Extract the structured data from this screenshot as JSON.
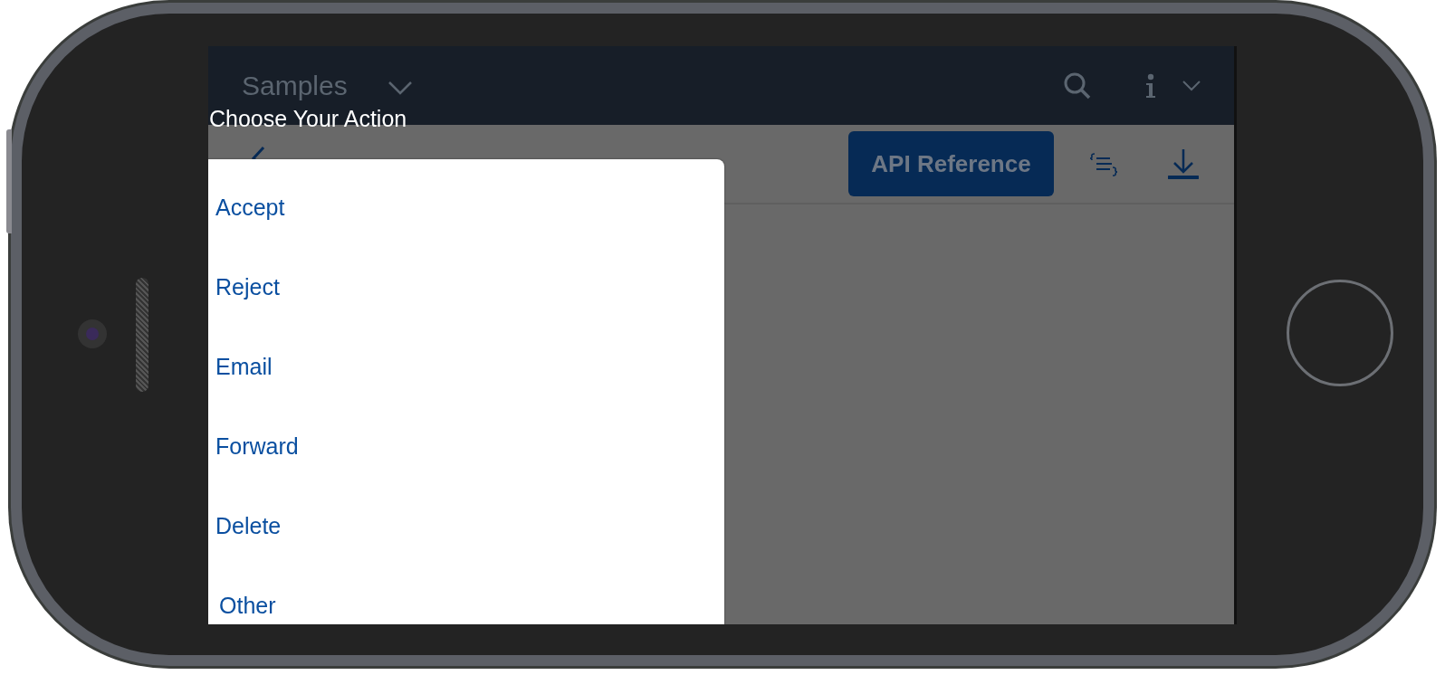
{
  "header": {
    "title": "Samples"
  },
  "page": {
    "api_button": "API Reference"
  },
  "action_sheet": {
    "title": "Choose Your Action",
    "actions": [
      {
        "label": "Accept",
        "kind": "plain"
      },
      {
        "label": "Reject",
        "kind": "plain"
      },
      {
        "label": "Email",
        "kind": "plain"
      },
      {
        "label": "Forward",
        "kind": "plain"
      },
      {
        "label": "Delete",
        "kind": "plain"
      },
      {
        "label": "Other",
        "kind": "indented"
      }
    ]
  }
}
